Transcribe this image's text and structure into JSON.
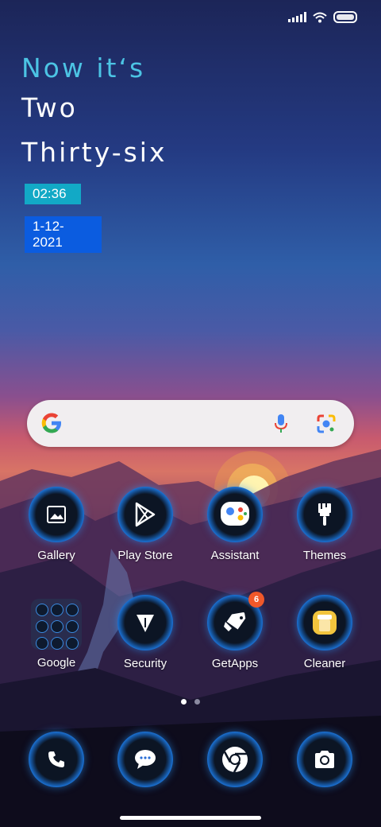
{
  "clock_widget": {
    "line1": "Now it‘s",
    "line2": "Two",
    "line3": "Thirty-six",
    "time_chip": "02:36",
    "date_chip": "1-12-2021"
  },
  "search_bar": {
    "logo_icon": "google-g-icon",
    "mic_icon": "mic-icon",
    "lens_icon": "lens-icon"
  },
  "apps": [
    {
      "label": "Gallery",
      "icon": "gallery-icon"
    },
    {
      "label": "Play Store",
      "icon": "play-store-icon"
    },
    {
      "label": "Assistant",
      "icon": "assistant-icon"
    },
    {
      "label": "Themes",
      "icon": "brush-icon"
    },
    {
      "label": "Google",
      "icon": "folder-icon"
    },
    {
      "label": "Security",
      "icon": "security-icon"
    },
    {
      "label": "GetApps",
      "icon": "getapps-icon",
      "badge": "6"
    },
    {
      "label": "Cleaner",
      "icon": "cleaner-icon"
    }
  ],
  "dock": [
    {
      "icon": "phone-icon"
    },
    {
      "icon": "messages-icon"
    },
    {
      "icon": "chrome-icon"
    },
    {
      "icon": "camera-icon"
    }
  ],
  "page_indicator": {
    "count": 2,
    "active": 0
  },
  "colors": {
    "accent_cyan": "#4cc4e4",
    "time_chip": "#12a9c6",
    "date_chip": "#0b5ce0",
    "badge": "#f0582a"
  }
}
